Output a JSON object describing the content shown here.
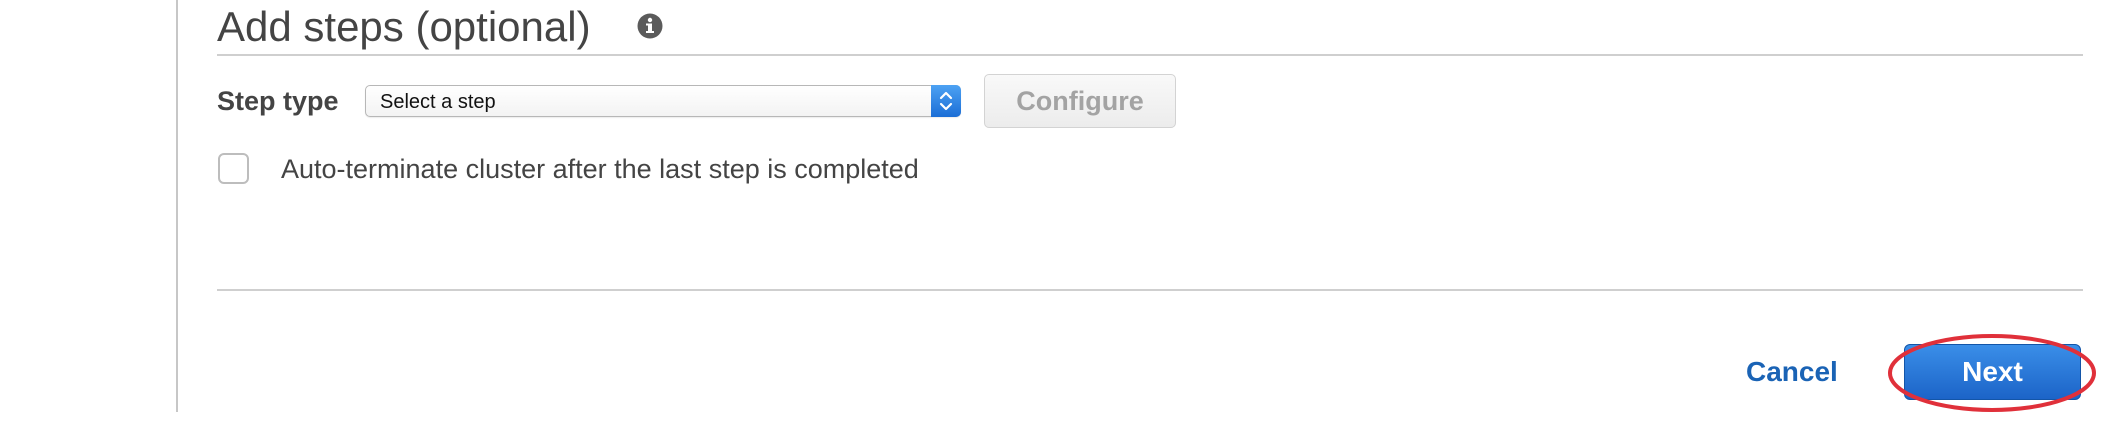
{
  "section": {
    "title": "Add steps (optional)",
    "info_icon": "info-icon"
  },
  "step_type": {
    "label": "Step type",
    "select_value": "Select a step",
    "configure_label": "Configure"
  },
  "auto_terminate": {
    "label": "Auto-terminate cluster after the last step is completed",
    "checked": false
  },
  "footer": {
    "cancel_label": "Cancel",
    "next_label": "Next"
  },
  "colors": {
    "primary_button": "#1c64c8",
    "link": "#1a63b5",
    "highlight": "#e0303a"
  }
}
